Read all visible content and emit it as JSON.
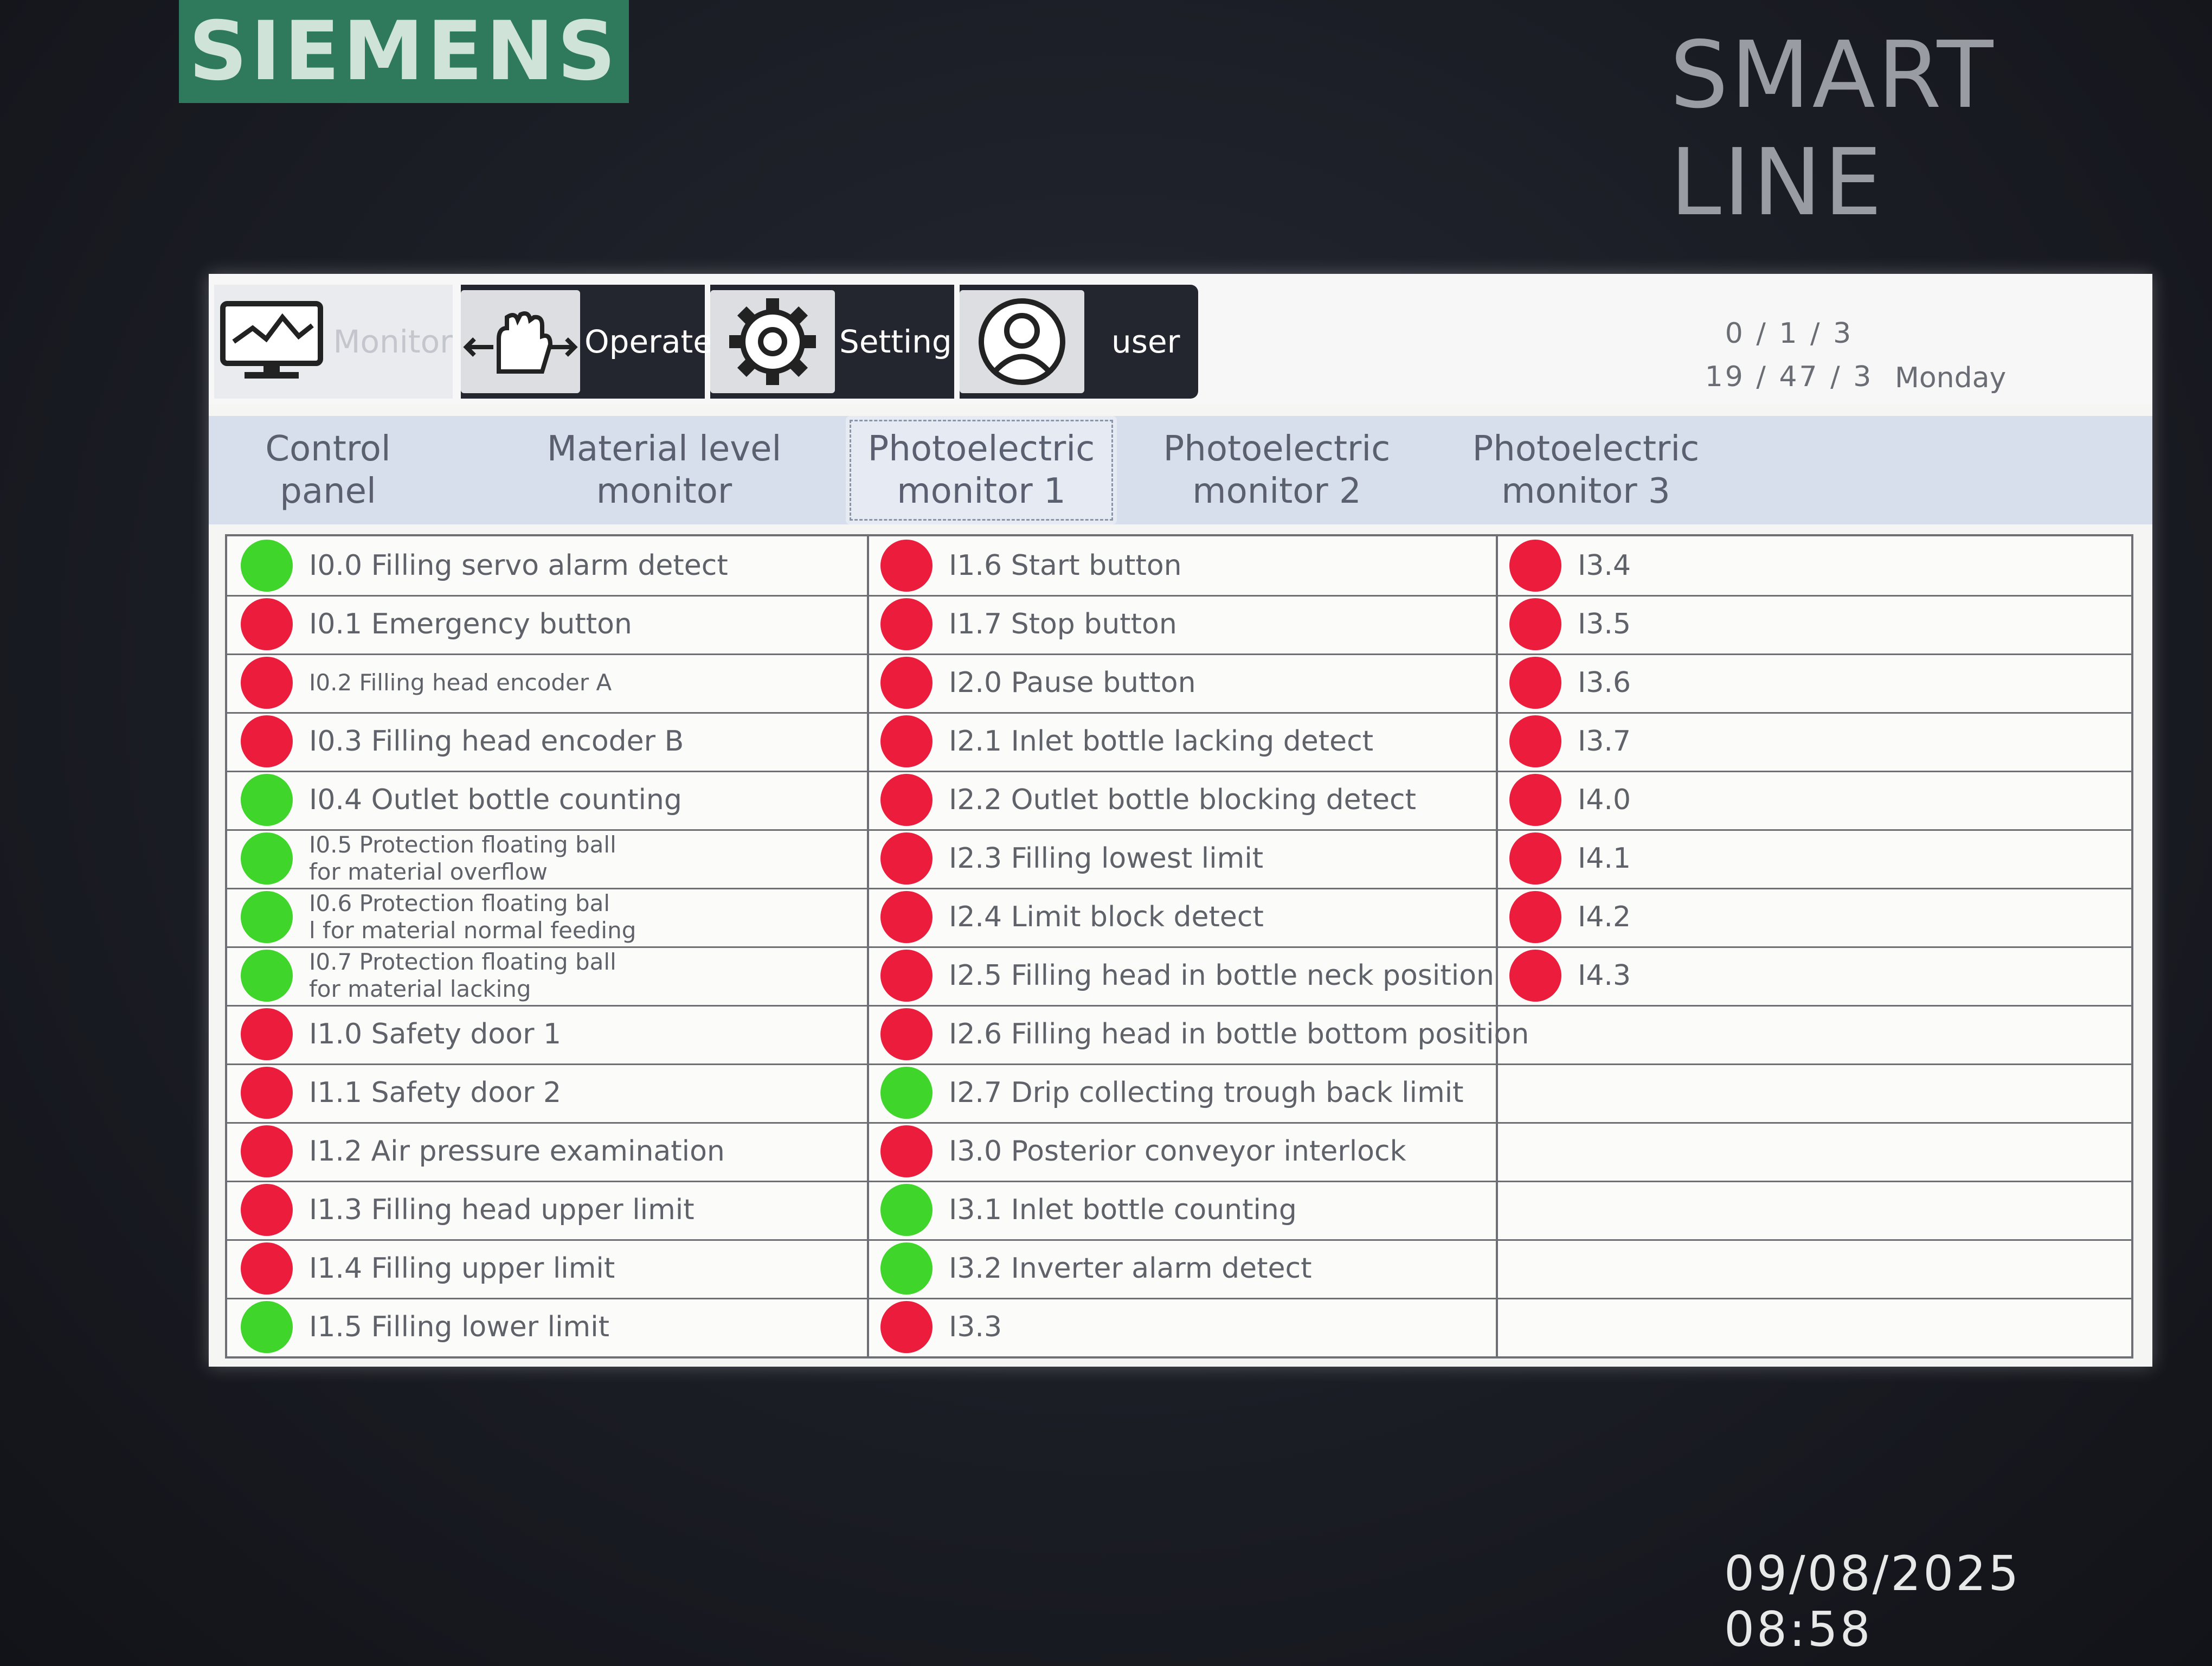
{
  "device": {
    "brand": "SIEMENS",
    "product_line": "SMART LINE"
  },
  "photo_timestamp": "09/08/2025 08:58",
  "nav": {
    "items": [
      {
        "label": "Monitor",
        "icon": "monitor-chart-icon"
      },
      {
        "label": "Operate",
        "icon": "hand-gesture-icon"
      },
      {
        "label": "Setting",
        "icon": "gear-icon"
      },
      {
        "label": "user",
        "icon": "user-icon"
      }
    ]
  },
  "clock": {
    "date": "0 / 1 / 3",
    "time": "19 / 47 / 3",
    "day": "Monday"
  },
  "tabs": [
    {
      "label": "Control panel",
      "active": false
    },
    {
      "label": "Material level\nmonitor",
      "active": false
    },
    {
      "label": "Photoelectric\nmonitor 1",
      "active": true
    },
    {
      "label": "Photoelectric\nmonitor 2",
      "active": false
    },
    {
      "label": "Photoelectric\nmonitor 3",
      "active": false
    }
  ],
  "colors": {
    "on": "#3fd52a",
    "off": "#ec1c3c"
  },
  "io_columns": [
    [
      {
        "label": "I0.0  Filling servo alarm detect",
        "state": "green"
      },
      {
        "label": "I0.1  Emergency button",
        "state": "red"
      },
      {
        "label": "I0.2 Filling head encoder A",
        "state": "red",
        "small": true
      },
      {
        "label": "I0.3  Filling head encoder B",
        "state": "red"
      },
      {
        "label": "I0.4 Outlet bottle counting",
        "state": "green"
      },
      {
        "label": "I0.5  Protection floating ball\n for material overflow",
        "state": "green",
        "small": true
      },
      {
        "label": "I0.6  Protection floating bal\nl for material normal feeding",
        "state": "green",
        "small": true
      },
      {
        "label": "I0.7  Protection floating ball\n for material lacking",
        "state": "green",
        "small": true
      },
      {
        "label": "I1.0  Safety door 1",
        "state": "red"
      },
      {
        "label": "I1.1 Safety door 2",
        "state": "red"
      },
      {
        "label": "I1.2  Air pressure examination",
        "state": "red"
      },
      {
        "label": "I1.3 Filling head upper limit",
        "state": "red"
      },
      {
        "label": "I1.4  Filling upper limit",
        "state": "red"
      },
      {
        "label": "I1.5  Filling lower limit",
        "state": "green"
      }
    ],
    [
      {
        "label": "I1.6  Start button",
        "state": "red"
      },
      {
        "label": "I1.7  Stop button",
        "state": "red"
      },
      {
        "label": "I2.0 Pause button",
        "state": "red"
      },
      {
        "label": "I2.1  Inlet bottle lacking detect",
        "state": "red"
      },
      {
        "label": "I2.2 Outlet bottle blocking detect",
        "state": "red"
      },
      {
        "label": "I2.3 Filling lowest limit",
        "state": "red"
      },
      {
        "label": "I2.4  Limit block detect",
        "state": "red"
      },
      {
        "label": "I2.5   Filling head in bottle neck position",
        "state": "red"
      },
      {
        "label": "I2.6 Filling head in bottle bottom position",
        "state": "red"
      },
      {
        "label": "I2.7 Drip collecting trough back limit",
        "state": "green"
      },
      {
        "label": "I3.0 Posterior conveyor interlock",
        "state": "red"
      },
      {
        "label": "I3.1 Inlet bottle counting",
        "state": "green"
      },
      {
        "label": "I3.2 Inverter alarm detect",
        "state": "green"
      },
      {
        "label": "I3.3",
        "state": "red"
      }
    ],
    [
      {
        "label": "I3.4",
        "state": "red"
      },
      {
        "label": "I3.5",
        "state": "red"
      },
      {
        "label": "I3.6",
        "state": "red"
      },
      {
        "label": "I3.7",
        "state": "red"
      },
      {
        "label": "I4.0",
        "state": "red"
      },
      {
        "label": "I4.1",
        "state": "red"
      },
      {
        "label": "I4.2",
        "state": "red"
      },
      {
        "label": "I4.3",
        "state": "red"
      }
    ]
  ]
}
